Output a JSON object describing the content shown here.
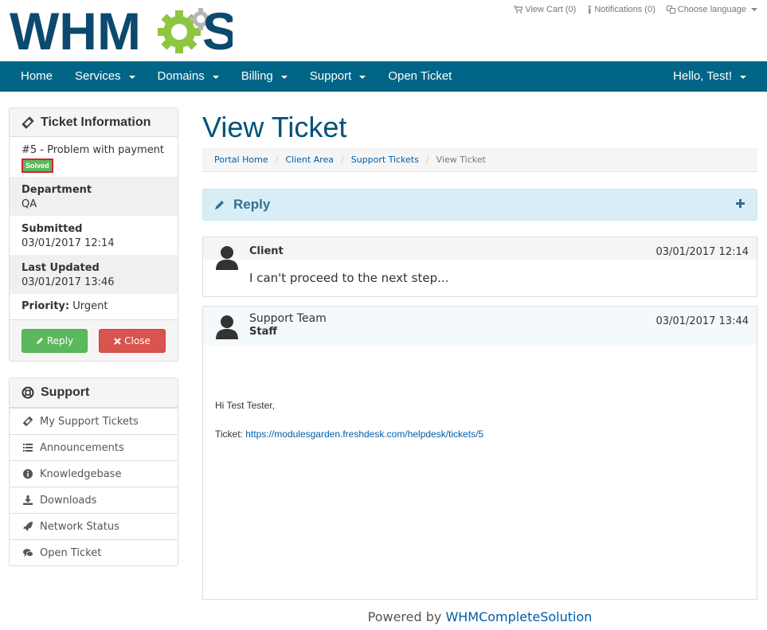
{
  "logo": {
    "text_pre": "WHM",
    "text_post": "S"
  },
  "top_links": {
    "cart": "View Cart (0)",
    "notifications": "Notifications (0)",
    "language": "Choose language"
  },
  "nav": {
    "items": [
      {
        "label": "Home",
        "caret": false
      },
      {
        "label": "Services",
        "caret": true
      },
      {
        "label": "Domains",
        "caret": true
      },
      {
        "label": "Billing",
        "caret": true
      },
      {
        "label": "Support",
        "caret": true
      },
      {
        "label": "Open Ticket",
        "caret": false
      }
    ],
    "user": "Hello, Test!"
  },
  "ticket_info": {
    "heading": "Ticket Information",
    "subject": "#5 - Problem with payment",
    "status": "Solved",
    "department_label": "Department",
    "department": "QA",
    "submitted_label": "Submitted",
    "submitted": "03/01/2017 12:14",
    "updated_label": "Last Updated",
    "updated": "03/01/2017 13:46",
    "priority_label": "Priority:",
    "priority": "Urgent",
    "reply_button": "Reply",
    "close_button": "Close"
  },
  "support_panel": {
    "heading": "Support",
    "items": [
      {
        "label": "My Support Tickets",
        "icon": "ticket-icon"
      },
      {
        "label": "Announcements",
        "icon": "list-icon"
      },
      {
        "label": "Knowledgebase",
        "icon": "info-icon"
      },
      {
        "label": "Downloads",
        "icon": "download-icon"
      },
      {
        "label": "Network Status",
        "icon": "rocket-icon"
      },
      {
        "label": "Open Ticket",
        "icon": "comments-icon"
      }
    ]
  },
  "main": {
    "title": "View Ticket",
    "breadcrumb": [
      "Portal Home",
      "Client Area",
      "Support Tickets",
      "View Ticket"
    ],
    "reply_heading": "Reply"
  },
  "messages": [
    {
      "author": "Client",
      "date": "03/01/2017 12:14",
      "body": "I can't proceed to the next step..."
    },
    {
      "author": "Support Team",
      "role": "Staff",
      "date": "03/01/2017 13:44",
      "greeting": "Hi Test Tester,",
      "ticket_label": "Ticket:",
      "ticket_link": "https://modulesgarden.freshdesk.com/helpdesk/tickets/5"
    }
  ],
  "footer": {
    "prefix": "Powered by",
    "link": "WHMCompleteSolution"
  },
  "colors": {
    "brand_dark": "#0b4a6e",
    "brand_green": "#8dc63f",
    "navbar": "#006586",
    "success": "#5cb85c",
    "danger": "#d9534f",
    "link": "#005da8"
  }
}
